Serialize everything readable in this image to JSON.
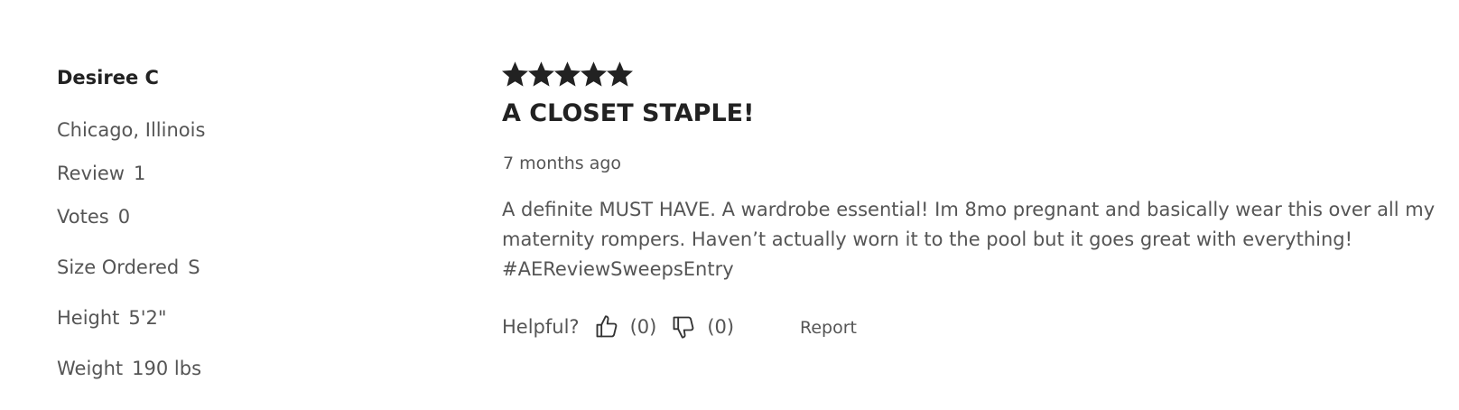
{
  "reviewer": {
    "name": "Desiree C",
    "location": "Chicago, Illinois",
    "review_label": "Review",
    "review_count": "1",
    "votes_label": "Votes",
    "votes_count": "0",
    "size_label": "Size Ordered",
    "size_value": "S",
    "height_label": "Height",
    "height_value": "5'2\"",
    "weight_label": "Weight",
    "weight_value": "190 lbs"
  },
  "review": {
    "rating": 5,
    "rating_max": 5,
    "star_color": "#222222",
    "title": "A CLOSET STAPLE!",
    "date": "7 months ago",
    "text_lines": [
      "A definite MUST HAVE. A wardrobe essential! Im 8mo pregnant and basically wear this over all my",
      "maternity rompers. Haven’t actually worn it to the pool but it goes great with everything!",
      "#AEReviewSweepsEntry"
    ]
  },
  "feedback": {
    "helpful_label": "Helpful?",
    "thumbs_up_icon": "thumbs-up-icon",
    "thumbs_up_count": "(0)",
    "thumbs_down_icon": "thumbs-down-icon",
    "thumbs_down_count": "(0)",
    "report_label": "Report"
  }
}
